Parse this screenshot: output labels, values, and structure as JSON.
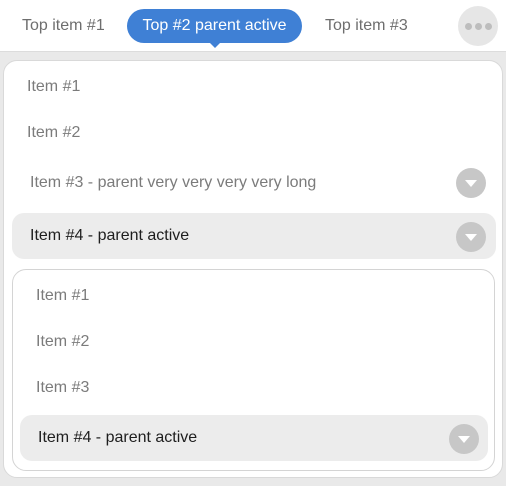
{
  "topnav": {
    "items": [
      {
        "label": "Top item #1",
        "active": false
      },
      {
        "label": "Top #2 parent active",
        "active": true
      },
      {
        "label": "Top item #3",
        "active": false
      }
    ],
    "more_icon": "more-horizontal-icon"
  },
  "menu": {
    "items": [
      {
        "label": "Item #1",
        "active": false,
        "has_children": false
      },
      {
        "label": "Item #2",
        "active": false,
        "has_children": false
      },
      {
        "label": "Item #3 - parent very very very very long",
        "active": false,
        "has_children": true
      },
      {
        "label": "Item #4 - parent active",
        "active": true,
        "has_children": true
      }
    ],
    "submenu": {
      "items": [
        {
          "label": "Item #1",
          "active": false,
          "has_children": false
        },
        {
          "label": "Item #2",
          "active": false,
          "has_children": false
        },
        {
          "label": "Item #3",
          "active": false,
          "has_children": false
        },
        {
          "label": "Item #4 - parent active",
          "active": true,
          "has_children": true
        }
      ]
    }
  },
  "colors": {
    "accent": "#3f80d5",
    "active_bg": "#ececec",
    "text_muted": "#7b7b7b",
    "chevron_bg": "#c7c7c7"
  }
}
